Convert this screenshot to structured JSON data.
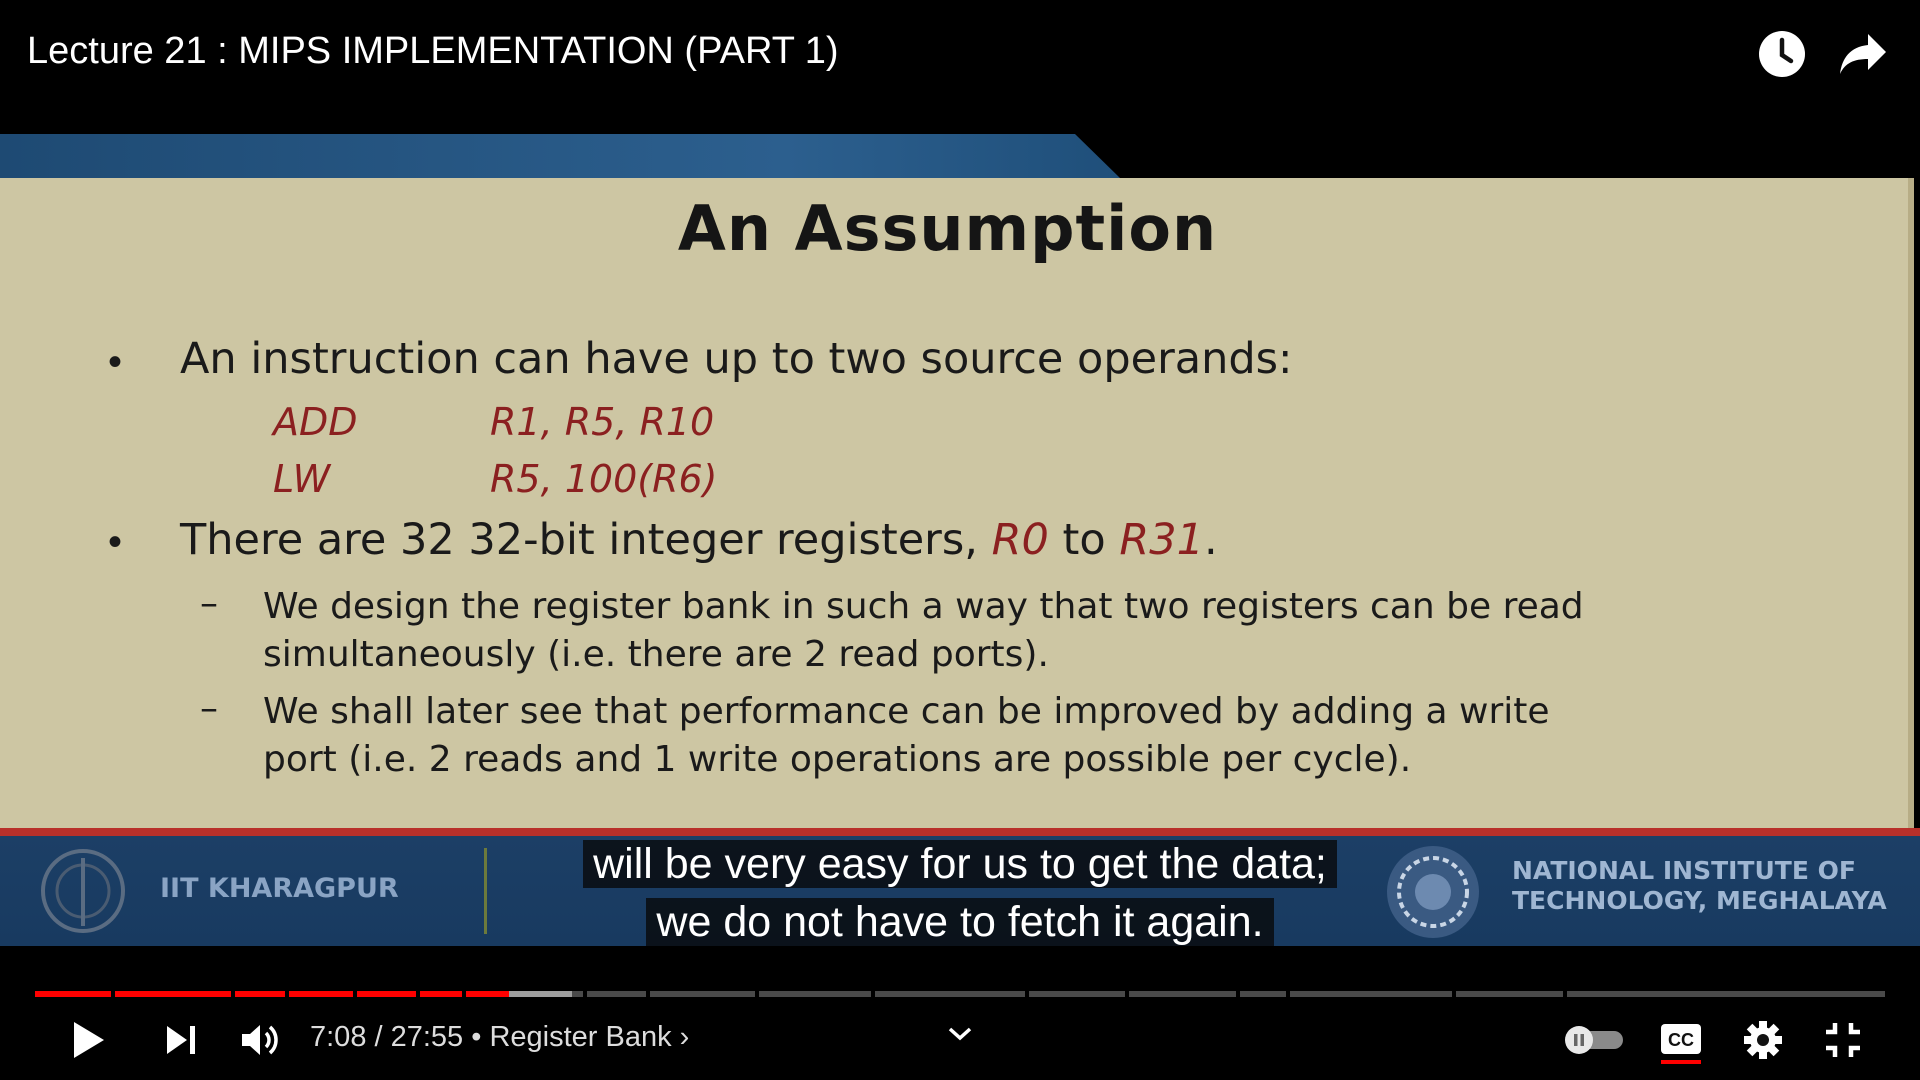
{
  "video": {
    "title": "Lecture 21 : MIPS IMPLEMENTATION (PART 1)"
  },
  "slide": {
    "title": "An Assumption",
    "bullet1": "An instruction can have up to two source operands:",
    "code": [
      {
        "op": "ADD",
        "args": "R1, R5, R10"
      },
      {
        "op": "LW",
        "args": "R5, 100(R6)"
      }
    ],
    "bullet2_pre": "There are 32 32-bit integer registers, ",
    "bullet2_r0": "R0",
    "bullet2_to": " to ",
    "bullet2_r31": "R31",
    "bullet2_end": ".",
    "sub1_line1": "We design the register bank in such a way that two registers can be read",
    "sub1_line2": "simultaneously (i.e. there are 2 read ports).",
    "sub2_line1": "We shall later see that performance can be improved by adding a write",
    "sub2_line2": "port (i.e. 2 reads and 1 write operations are possible per cycle).",
    "dash": "–",
    "bullet_dot": "•",
    "footer_left": "IIT KHARAGPUR",
    "footer_right_line1": "NATIONAL INSTITUTE OF",
    "footer_right_line2": "TECHNOLOGY, MEGHALAYA"
  },
  "captions": {
    "line1": "will be very easy for us to get the data;",
    "line2": "we do not have to fetch it again."
  },
  "player": {
    "time": "7:08 / 27:55 • Register Bank ›",
    "progress_fraction": 0.256,
    "buffer_fraction": 0.29,
    "colors": {
      "played": "#ff0000",
      "buffered": "#9e9e9e",
      "track": "#4a4a4a"
    },
    "icons": [
      "watch-later-icon",
      "share-icon",
      "play-icon",
      "next-icon",
      "volume-icon",
      "chevron-down-icon",
      "autoplay-toggle-icon",
      "captions-icon",
      "settings-icon",
      "exit-fullscreen-icon"
    ]
  }
}
